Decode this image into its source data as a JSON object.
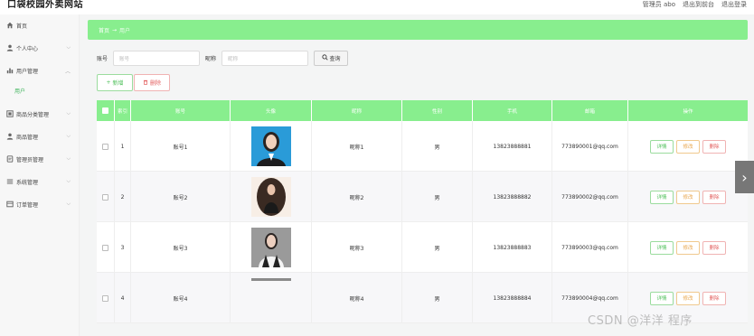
{
  "header": {
    "brand": "口袋校园外卖网站",
    "admin_label": "管理员 abo",
    "exit_front": "退出到前台",
    "logout": "退出登录"
  },
  "sidebar": {
    "items": [
      {
        "label": "首页",
        "icon": "home-icon"
      },
      {
        "label": "个人中心",
        "icon": "user-icon"
      },
      {
        "label": "用户管理",
        "icon": "chart-icon"
      },
      {
        "label": "商品分类管理",
        "icon": "list-icon"
      },
      {
        "label": "商品管理",
        "icon": "user-icon"
      },
      {
        "label": "管理员管理",
        "icon": "doc-icon"
      },
      {
        "label": "系统管理",
        "icon": "menu-icon"
      },
      {
        "label": "订单管理",
        "icon": "table-icon"
      }
    ],
    "sub_active": "用户"
  },
  "breadcrumb": {
    "home": "首页",
    "separator": "→",
    "current": "用户"
  },
  "search": {
    "account_label": "账号",
    "account_placeholder": "账号",
    "nickname_label": "昵称",
    "nickname_placeholder": "昵称",
    "button": "查询"
  },
  "actions": {
    "add": "新增",
    "delete": "删除"
  },
  "table": {
    "columns": [
      "索引",
      "账号",
      "头像",
      "昵称",
      "性别",
      "手机",
      "邮箱",
      "操作"
    ],
    "rows": [
      {
        "index": "1",
        "account": "账号1",
        "nickname": "昵称1",
        "gender": "男",
        "phone": "13823888881",
        "email": "773890001@qq.com"
      },
      {
        "index": "2",
        "account": "账号2",
        "nickname": "昵称2",
        "gender": "男",
        "phone": "13823888882",
        "email": "773890002@qq.com"
      },
      {
        "index": "3",
        "account": "账号3",
        "nickname": "昵称3",
        "gender": "男",
        "phone": "13823888883",
        "email": "773890003@qq.com"
      },
      {
        "index": "4",
        "account": "账号4",
        "nickname": "昵称4",
        "gender": "男",
        "phone": "13823888884",
        "email": "773890004@qq.com"
      }
    ],
    "op_detail": "详情",
    "op_edit": "修改",
    "op_delete": "删除"
  },
  "watermark": "CSDN @洋洋 程序",
  "colors": {
    "accent": "#88ee8e",
    "success": "#4bbf57",
    "warning": "#e8a44a",
    "danger": "#e36060"
  }
}
